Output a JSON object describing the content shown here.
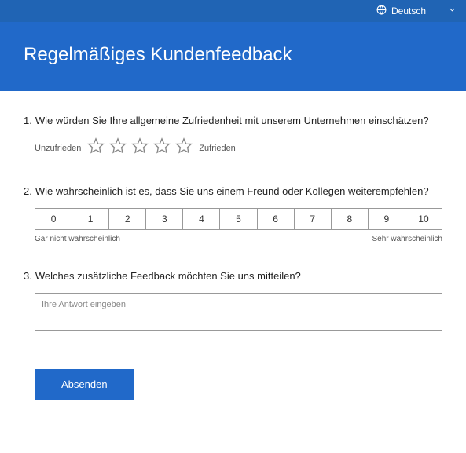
{
  "lang": {
    "label": "Deutsch"
  },
  "header": {
    "title": "Regelmäßiges Kundenfeedback"
  },
  "q1": {
    "num": "1.",
    "text": "Wie würden Sie Ihre allgemeine Zufriedenheit mit unserem Unternehmen einschätzen?",
    "low": "Unzufrieden",
    "high": "Zufrieden"
  },
  "q2": {
    "num": "2.",
    "text": "Wie wahrscheinlich ist es, dass Sie uns einem Freund oder Kollegen weiterempfehlen?",
    "low": "Gar nicht wahrscheinlich",
    "high": "Sehr wahrscheinlich",
    "scale": [
      "0",
      "1",
      "2",
      "3",
      "4",
      "5",
      "6",
      "7",
      "8",
      "9",
      "10"
    ]
  },
  "q3": {
    "num": "3.",
    "text": "Welches zusätzliche Feedback möchten Sie uns mitteilen?",
    "placeholder": "Ihre Antwort eingeben"
  },
  "submit": {
    "label": "Absenden"
  }
}
